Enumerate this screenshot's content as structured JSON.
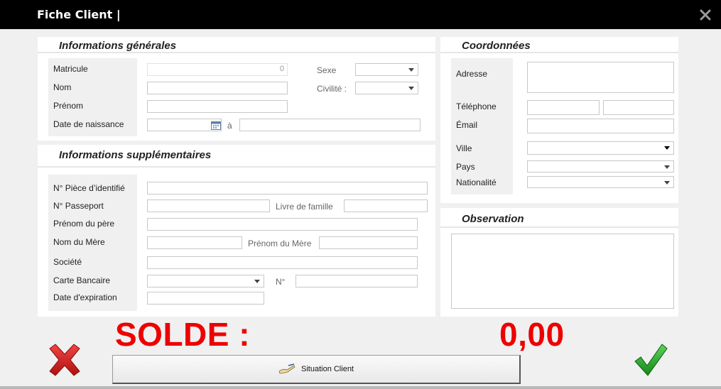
{
  "window": {
    "title": "Fiche Client |"
  },
  "general": {
    "title": "Informations générales",
    "matricule_label": "Matricule",
    "matricule_value": "0",
    "nom_label": "Nom",
    "prenom_label": "Prénom",
    "naissance_label": "Date de naissance",
    "a_label": "à",
    "sexe_label": "Sexe",
    "civilite_label": "Civilité :"
  },
  "supplementaires": {
    "title": "Informations supplémentaires",
    "piece_label": "N° Pièce d’identifié",
    "passeport_label": "N° Passeport",
    "livre_label": "Livre de famille",
    "pere_label": "Prénom du père",
    "mere_nom_label": "Nom du Mère",
    "mere_prenom_label": "Prénom du Mère",
    "societe_label": "Société",
    "carte_label": "Carte Bancaire",
    "numero_label": "N°",
    "expiration_label": "Date d'expiration"
  },
  "coordonnees": {
    "title": "Coordonnées",
    "adresse_label": "Adresse",
    "telephone_label": "Téléphone",
    "email_label": "Émail",
    "ville_label": "Ville",
    "pays_label": "Pays",
    "nationalite_label": "Nationalité"
  },
  "observation": {
    "title": "Observation"
  },
  "solde": {
    "label": "SOLDE :",
    "value": "0,00"
  },
  "actions": {
    "situation_label": "Situation Client"
  },
  "icons": {
    "close": "close-icon",
    "cancel": "red-x-icon",
    "confirm": "green-check-icon",
    "situation": "hand-pen-icon",
    "calendar": "calendar-icon"
  },
  "colors": {
    "solde": "#ee0000",
    "cancel": "#d21f1f",
    "confirm": "#1e9e1e"
  }
}
